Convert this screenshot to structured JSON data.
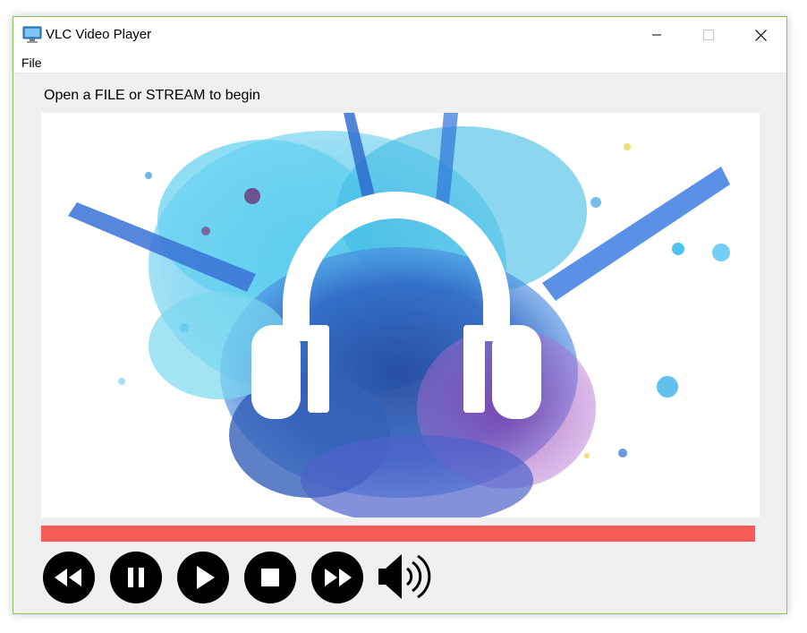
{
  "window": {
    "title": "VLC Video Player"
  },
  "menu": {
    "file_label": "File"
  },
  "status": {
    "hint": "Open a FILE or STREAM to begin"
  },
  "player": {
    "progress": 1.0
  },
  "colors": {
    "progress_bar": "#f75b58",
    "window_border": "#8fbf5f",
    "control_fill": "#000000"
  },
  "controls": [
    {
      "name": "rewind-button",
      "icon": "rewind-icon"
    },
    {
      "name": "pause-button",
      "icon": "pause-icon"
    },
    {
      "name": "play-button",
      "icon": "play-icon"
    },
    {
      "name": "stop-button",
      "icon": "stop-icon"
    },
    {
      "name": "fast-forward-button",
      "icon": "fast-forward-icon"
    },
    {
      "name": "volume-button",
      "icon": "speaker-icon"
    }
  ]
}
